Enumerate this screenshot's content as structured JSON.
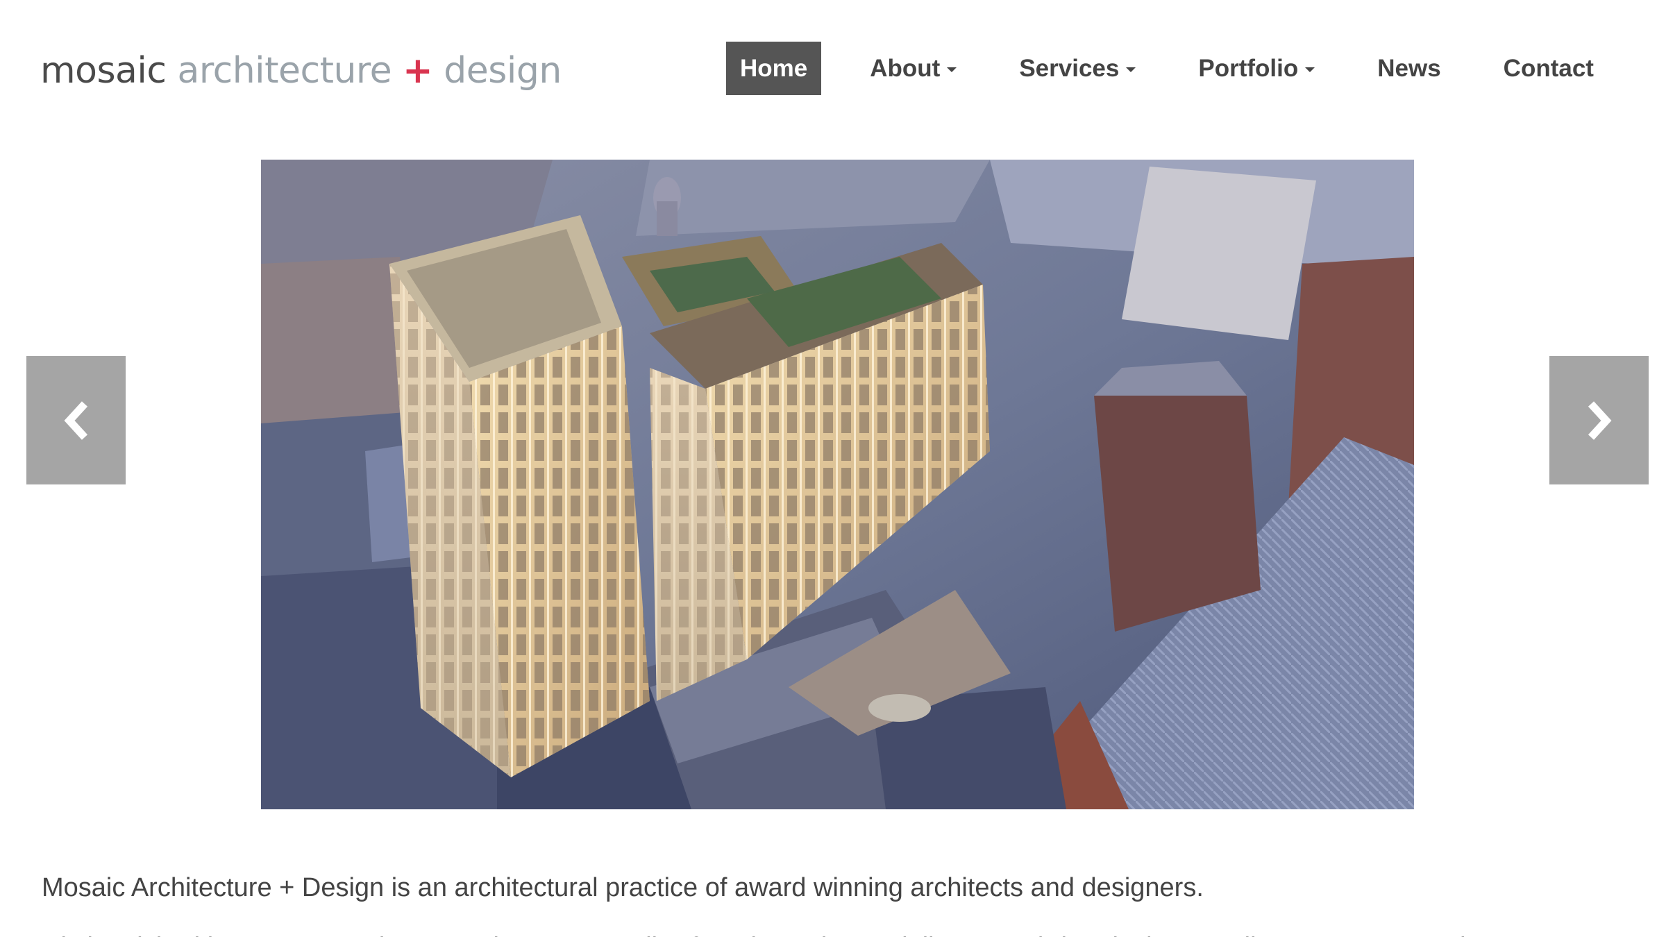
{
  "logo": {
    "part1": "mosaic",
    "part2": "architecture",
    "part3": "+",
    "part4": "design"
  },
  "nav": {
    "home": "Home",
    "about": "About",
    "services": "Services",
    "portfolio": "Portfolio",
    "news": "News",
    "contact": "Contact"
  },
  "carousel": {
    "prev_icon": "chevron-left-icon",
    "next_icon": "chevron-right-icon"
  },
  "content": {
    "intro": "Mosaic Architecture + Design is an architectural practice of award winning architects and designers.",
    "second_line": "Distinguished by an unwavering commitment to quality, from inception to delivery, we bring design excellence to every project."
  },
  "colors": {
    "nav_active_bg": "#555555",
    "arrow_bg": "#a5a5a5",
    "logo_accent": "#d9344f"
  }
}
